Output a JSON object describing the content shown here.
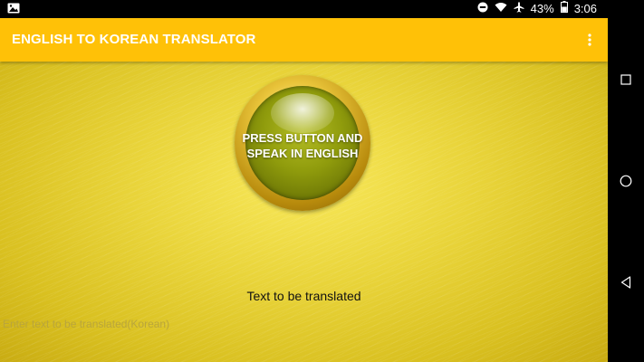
{
  "status_bar": {
    "battery_percent": "43%",
    "time": "3:06"
  },
  "app_bar": {
    "title": "ENGLISH TO KOREAN TRANSLATOR"
  },
  "main": {
    "speak_button_label": "PRESS BUTTON AND\nSPEAK IN ENGLISH",
    "translate_label": "Text to be translated",
    "input": {
      "value": "",
      "placeholder": "Enter text to be translated(Korean)"
    }
  },
  "colors": {
    "app_bar": "#FFC107",
    "background": "#E9D43A",
    "button_ring": "#B78A0C",
    "button_core": "#8F9B0C"
  },
  "icons": {
    "status_left": "image-icon",
    "status_right": [
      "dnd-icon",
      "wifi-icon",
      "airplane-icon",
      "battery-icon"
    ],
    "app_bar": "overflow-menu-icon",
    "nav": [
      "recents-icon",
      "home-icon",
      "back-icon"
    ]
  }
}
